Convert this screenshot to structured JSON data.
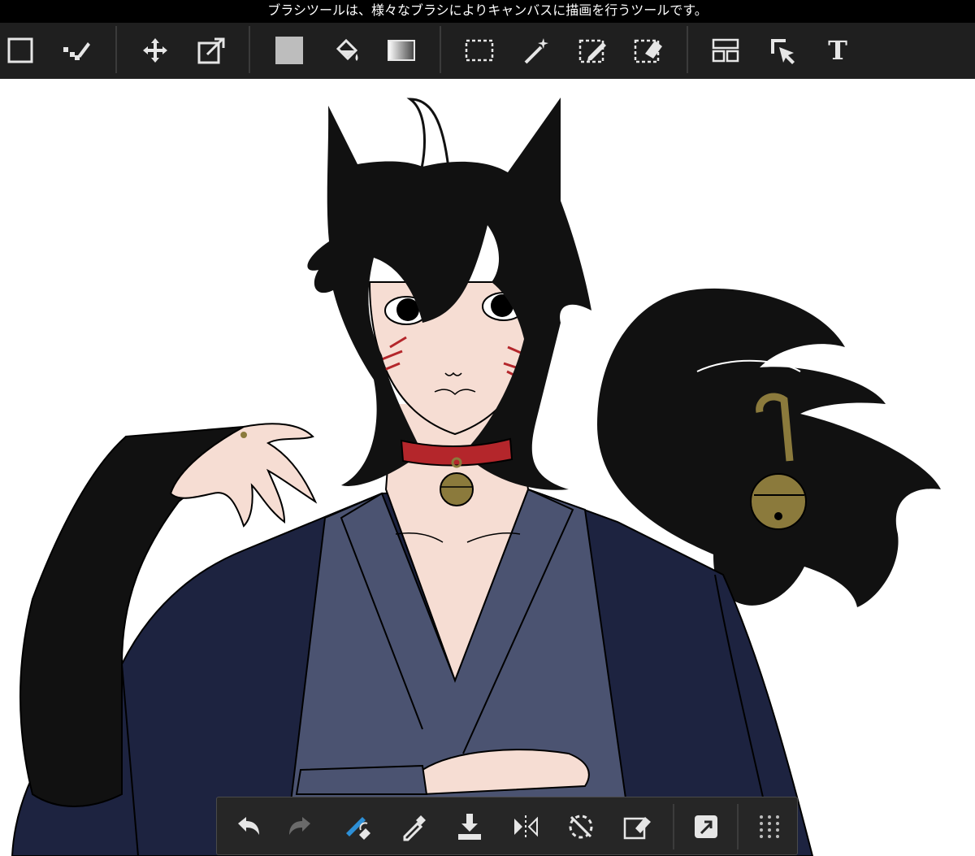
{
  "hint": {
    "text": "ブラシツールは、様々なブラシによりキャンバスに描画を行うツールです。"
  },
  "colors": {
    "toolbar_bg": "#1f1f1f",
    "hint_bg": "#000000",
    "icon": "#e6e6e6",
    "active_brush": "#2d8fd6",
    "hair": "#111111",
    "skin": "#f6ddd3",
    "kimono_outer": "#1d2340",
    "kimono_inner": "#4b5371",
    "collar": "#b4262b",
    "bell": "#8b7a3c"
  },
  "top_toolbar": {
    "tools": [
      {
        "id": "select-frame",
        "icon": "square-outline-icon"
      },
      {
        "id": "dot-pen",
        "icon": "dot-pen-icon"
      },
      {
        "id": "move",
        "icon": "move-arrows-icon"
      },
      {
        "id": "transform",
        "icon": "transform-icon"
      },
      {
        "id": "fill-color",
        "icon": "gray-fill-swatch-icon"
      },
      {
        "id": "bucket",
        "icon": "paint-bucket-icon"
      },
      {
        "id": "gradient",
        "icon": "gradient-icon"
      },
      {
        "id": "selection",
        "icon": "selection-rect-icon"
      },
      {
        "id": "magic-wand",
        "icon": "magic-wand-icon"
      },
      {
        "id": "selection-pen",
        "icon": "selection-pen-icon"
      },
      {
        "id": "selection-eraser",
        "icon": "selection-eraser-icon"
      },
      {
        "id": "frame-divider",
        "icon": "frame-divider-icon"
      },
      {
        "id": "operation",
        "icon": "pointer-icon"
      },
      {
        "id": "text",
        "icon": "text-tool-icon",
        "glyph": "T"
      }
    ]
  },
  "bottom_bar": {
    "tools": [
      {
        "id": "undo",
        "icon": "undo-icon"
      },
      {
        "id": "redo",
        "icon": "redo-icon"
      },
      {
        "id": "brush-eraser-switch",
        "icon": "brush-eraser-icon"
      },
      {
        "id": "eyedropper",
        "icon": "eyedropper-icon"
      },
      {
        "id": "import",
        "icon": "download-icon"
      },
      {
        "id": "flip",
        "icon": "flip-horizontal-icon"
      },
      {
        "id": "snap",
        "icon": "snap-off-icon"
      },
      {
        "id": "clear",
        "icon": "clear-icon"
      },
      {
        "id": "share",
        "icon": "share-icon"
      },
      {
        "id": "more",
        "icon": "grid-dots-icon"
      }
    ]
  }
}
